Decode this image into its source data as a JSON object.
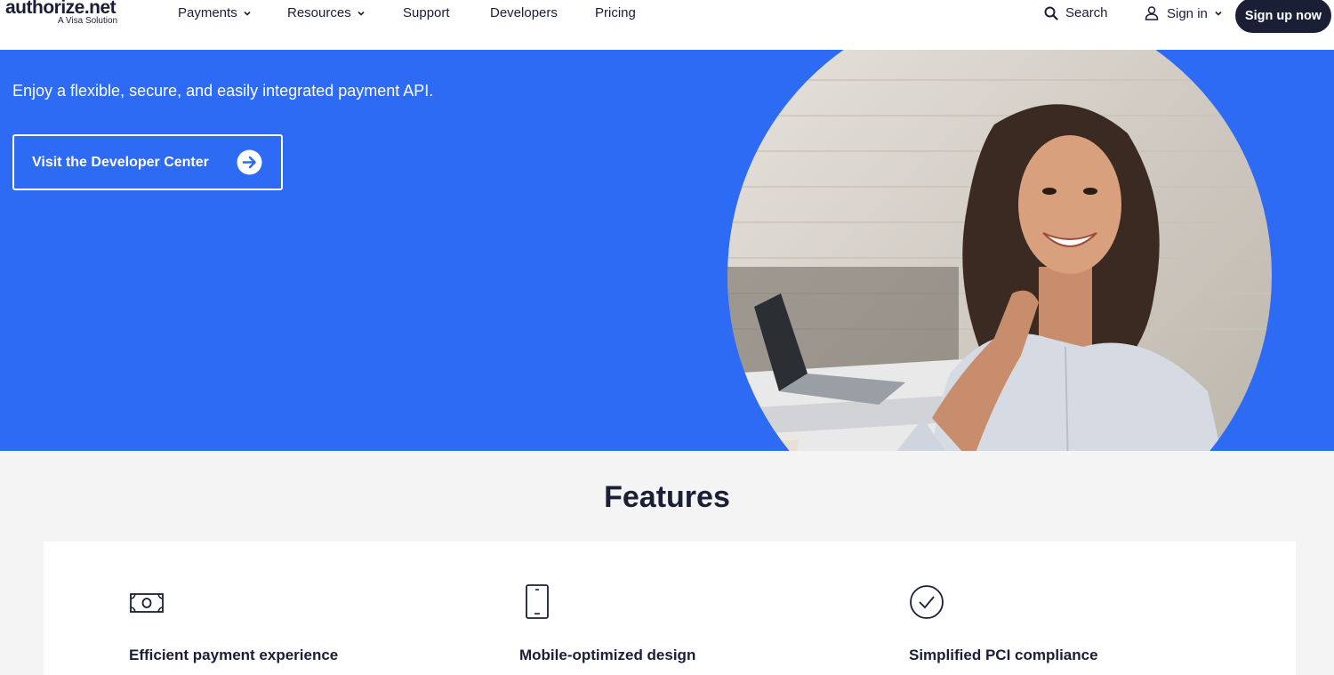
{
  "brand": {
    "name": "authorize.net",
    "tagline": "A Visa Solution"
  },
  "nav": {
    "items": [
      {
        "label": "Payments",
        "has_dropdown": true
      },
      {
        "label": "Resources",
        "has_dropdown": true
      },
      {
        "label": "Support",
        "has_dropdown": false
      },
      {
        "label": "Developers",
        "has_dropdown": false
      },
      {
        "label": "Pricing",
        "has_dropdown": false
      }
    ],
    "search_label": "Search",
    "signin_label": "Sign in",
    "signup_label": "Sign up now"
  },
  "hero": {
    "text": "Enjoy a flexible, secure, and easily integrated payment API.",
    "cta_label": "Visit the Developer Center"
  },
  "features": {
    "title": "Features",
    "items": [
      {
        "label": "Efficient payment experience",
        "icon": "cash-icon"
      },
      {
        "label": "Mobile-optimized design",
        "icon": "mobile-phone-icon"
      },
      {
        "label": "Simplified PCI compliance",
        "icon": "check-circle-icon"
      }
    ]
  },
  "colors": {
    "hero_bg": "#2d6bf5",
    "dark": "#1a1f36",
    "page_bg": "#f4f4f4"
  }
}
